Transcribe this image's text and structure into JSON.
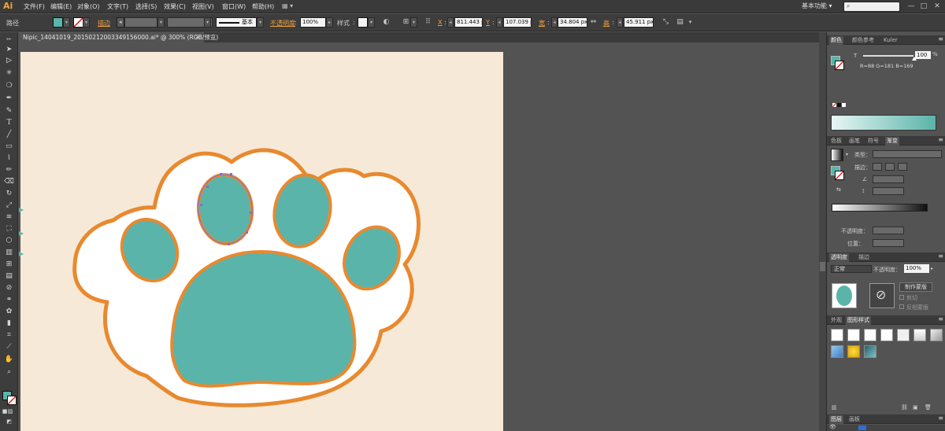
{
  "app": {
    "logo": "Ai",
    "menus": [
      "文件(F)",
      "编辑(E)",
      "对象(O)",
      "文字(T)",
      "选择(S)",
      "效果(C)",
      "视图(V)",
      "窗口(W)",
      "帮助(H)"
    ],
    "workspace": "基本功能",
    "window_buttons": [
      "—",
      "□",
      "✕"
    ]
  },
  "control_bar": {
    "selection_label": "路径",
    "stroke_label": "描边",
    "stroke_style": "基本",
    "opacity_label": "不透明度",
    "opacity_value": "100%",
    "style_label": "样式",
    "x_label": "X",
    "x_value": "811.443 p",
    "y_label": "Y",
    "y_value": "107.039 p",
    "w_label": "宽",
    "w_value": "34.804 px",
    "h_label": "高",
    "h_value": "45.911 px"
  },
  "document": {
    "tab_title": "Nipic_14041019_20150212003349156000.ai* @ 300% (RGB/预览)",
    "close": "✕"
  },
  "colors": {
    "teal": "#5ab4a9",
    "orange": "#e8892f",
    "artboard": "#f6e9d8",
    "white": "#ffffff"
  },
  "color_panel": {
    "tabs": [
      "颜色",
      "颜色参考",
      "Kuler"
    ],
    "tint_label": "T",
    "tint_value": "100",
    "rgb_readout": "R=88 G=181 B=169"
  },
  "gradient_panel": {
    "tabs": [
      "色板",
      "画笔",
      "符号",
      "渐变"
    ],
    "type_label": "类型：",
    "stroke_label": "描边：",
    "opacity_label": "不透明度：",
    "position_label": "位置："
  },
  "transparency_panel": {
    "tabs": [
      "透明度",
      "描边"
    ],
    "mode": "正常",
    "opacity_label": "不透明度：",
    "opacity_value": "100%",
    "make_mask": "制作蒙版",
    "clip": "剪切",
    "invert_mask": "反相蒙版"
  },
  "graphic_styles_panel": {
    "tabs": [
      "外观",
      "图形样式"
    ]
  },
  "layers_panel": {
    "tabs": [
      "图层",
      "画板"
    ]
  }
}
